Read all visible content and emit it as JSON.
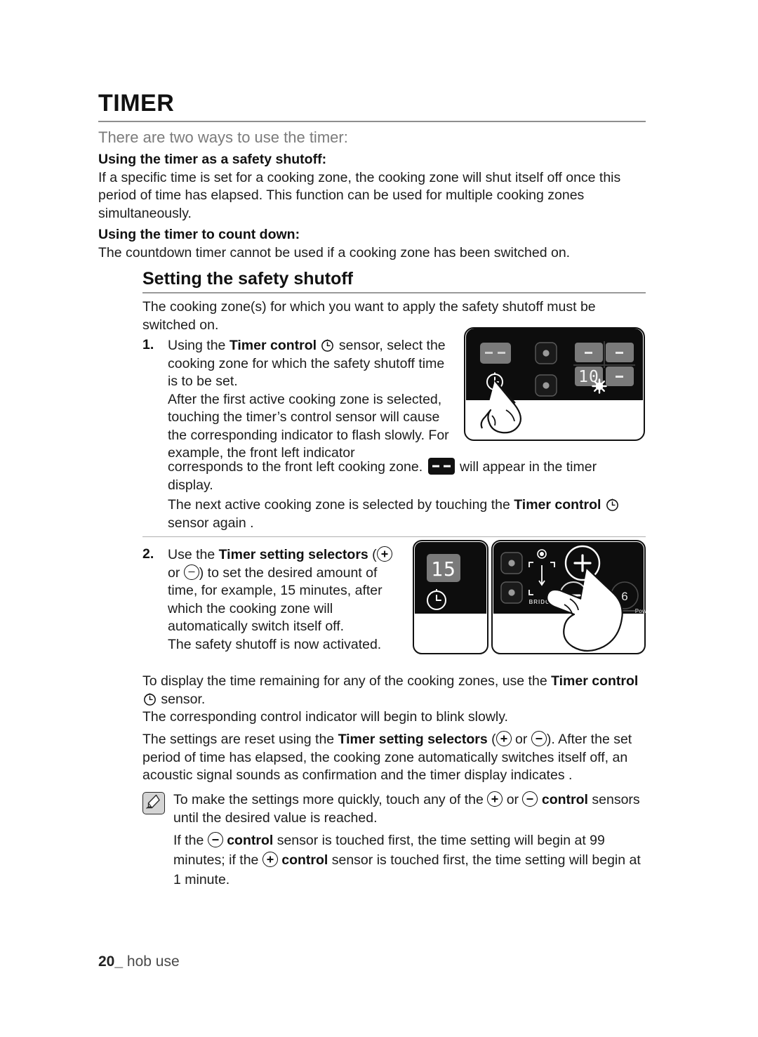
{
  "document": {
    "chapter_title": "TIMER",
    "intro": "There are two ways to use the timer:",
    "safety_shutoff_heading": "Using the timer as a safety shutoff:",
    "safety_shutoff_body": "If a specific time is set for a cooking zone, the cooking zone will shut itself off once this period of time has elapsed. This function can be used for multiple cooking zones simultaneously.",
    "count_down_heading": "Using the timer to count down:",
    "count_down_body": "The countdown timer cannot be used if a cooking zone has been switched on.",
    "section_title": "Setting the safety shutoff",
    "section_intro": "The cooking zone(s) for which you want to apply the safety shutoff must be switched on.",
    "step1": {
      "number": "1.",
      "part_a": "Using the ",
      "bold_a": "Timer control",
      "part_b": " sensor, select the cooking zone for which the safety shutoff time is to be set.",
      "part_c": "After the first active cooking zone is selected, touching the timer’s control sensor will cause the corresponding indicator to flash slowly. For example, the front left indicator",
      "part_d": "corresponds to the front left cooking zone. ",
      "part_e": " will appear in the timer display.",
      "part_f": "The next active cooking zone is selected by touching the ",
      "bold_f": "Timer control",
      "part_g": " sensor again ."
    },
    "step2": {
      "number": "2.",
      "part_a": "Use the ",
      "bold_a": "Timer setting selectors",
      "part_b": " (",
      "part_c": " or ",
      "part_d": ") to set the desired amount of time, for example, 15 minutes, after which the cooking zone will automatically switch itself off.",
      "part_e": "The safety shutoff is now activated."
    },
    "closing": {
      "line1_a": "To display the time remaining for any of the cooking zones, use the ",
      "line1_bold": "Timer control",
      "line1_b": " sensor.",
      "line2": "The corresponding control indicator will begin to blink slowly.",
      "line3_a": "The settings are reset using the ",
      "line3_bold": "Timer setting selectors",
      "line3_b": " (",
      "line3_c": " or ",
      "line3_d": "). After the set period of time has elapsed, the cooking zone automatically switches itself off, an acoustic signal sounds as confirmation and the timer display indicates ."
    },
    "note": {
      "icon": "note-pen-icon",
      "line1_a": "To make the settings more quickly, touch any of the ",
      "line1_b": " or ",
      "line1_bold": "control",
      "line1_c": " sensors until the desired value is reached.",
      "line2_a": "If the ",
      "line2_bold_a": "control",
      "line2_b": " sensor is touched first, the time setting will begin at 99 minutes; if the ",
      "line2_bold_b": "control",
      "line2_c": " sensor is touched first, the time setting will begin at 1 minute."
    },
    "footer": {
      "page_number": "20",
      "underscore": "_",
      "section": "hob use"
    }
  },
  "illustrations": {
    "panel1": {
      "name": "hob-timer-select-panel",
      "timer_display": "--",
      "timer_icon": "clock-icon",
      "zone_indicator_top": "zone-indicator-dot",
      "zone_indicator_bottom": "zone-indicator-dot",
      "segments": [
        "-",
        "-",
        "10",
        "-"
      ],
      "flash_marker": "starburst-icon",
      "hand": "finger-pointing-icon"
    },
    "panel2_left": {
      "name": "hob-timer-15-panel",
      "timer_display": "15",
      "timer_icon": "clock-icon"
    },
    "panel2_right": {
      "name": "hob-plus-minus-panel",
      "zone_indicator_top": "zone-indicator-dot",
      "zone_indicator_bottom": "zone-indicator-dot",
      "bridge_label": "BRIDGE",
      "bridge_icon": "bridge-bracket-icon",
      "plus_label": "+",
      "minus_label": "−",
      "power_level": "6",
      "power_label": "Pow",
      "hand": "finger-pointing-icon"
    }
  },
  "colors": {
    "panel_black": "#0d0d0d",
    "segment_gray": "#7a7a7a",
    "rule_gray": "#8e8e8e",
    "intro_gray": "#7b7b7b",
    "note_icon_gray": "#d4d4d4"
  }
}
